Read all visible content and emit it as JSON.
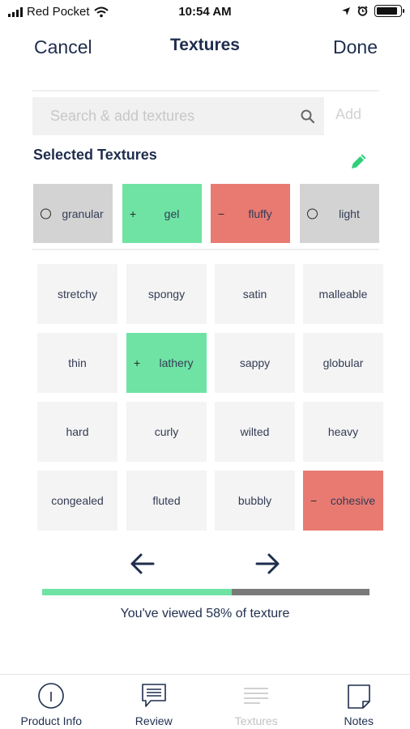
{
  "status_bar": {
    "carrier": "Red Pocket",
    "time": "10:54 AM",
    "battery_level": 0.9
  },
  "nav": {
    "cancel": "Cancel",
    "title": "Textures",
    "done": "Done"
  },
  "search": {
    "placeholder": "Search & add textures",
    "value": "",
    "add": "Add"
  },
  "selected": {
    "label": "Selected Textures",
    "items": [
      {
        "label": "granular",
        "state": "neutral"
      },
      {
        "label": "gel",
        "state": "positive"
      },
      {
        "label": "fluffy",
        "state": "negative"
      },
      {
        "label": "light",
        "state": "neutral"
      }
    ]
  },
  "textures": [
    {
      "label": "stretchy",
      "state": "none"
    },
    {
      "label": "spongy",
      "state": "none"
    },
    {
      "label": "satin",
      "state": "none"
    },
    {
      "label": "malleable",
      "state": "none"
    },
    {
      "label": "thin",
      "state": "none"
    },
    {
      "label": "lathery",
      "state": "positive"
    },
    {
      "label": "sappy",
      "state": "none"
    },
    {
      "label": "globular",
      "state": "none"
    },
    {
      "label": "hard",
      "state": "none"
    },
    {
      "label": "curly",
      "state": "none"
    },
    {
      "label": "wilted",
      "state": "none"
    },
    {
      "label": "heavy",
      "state": "none"
    },
    {
      "label": "congealed",
      "state": "none"
    },
    {
      "label": "fluted",
      "state": "none"
    },
    {
      "label": "bubbly",
      "state": "none"
    },
    {
      "label": "cohesive",
      "state": "negative"
    }
  ],
  "marks": {
    "positive": "+",
    "negative": "−"
  },
  "progress": {
    "percent": 58,
    "text": "You've viewed 58% of texture"
  },
  "tabs": [
    {
      "label": "Product Info",
      "icon": "info-icon"
    },
    {
      "label": "Review",
      "icon": "comment-icon"
    },
    {
      "label": "Textures",
      "icon": "lines-icon"
    },
    {
      "label": "Notes",
      "icon": "notes-icon"
    }
  ],
  "colors": {
    "positive": "#6ee3a4",
    "negative": "#e87a72",
    "neutral": "#d3d3d3",
    "accent": "#2fcf7a",
    "text": "#1f2d4d"
  }
}
